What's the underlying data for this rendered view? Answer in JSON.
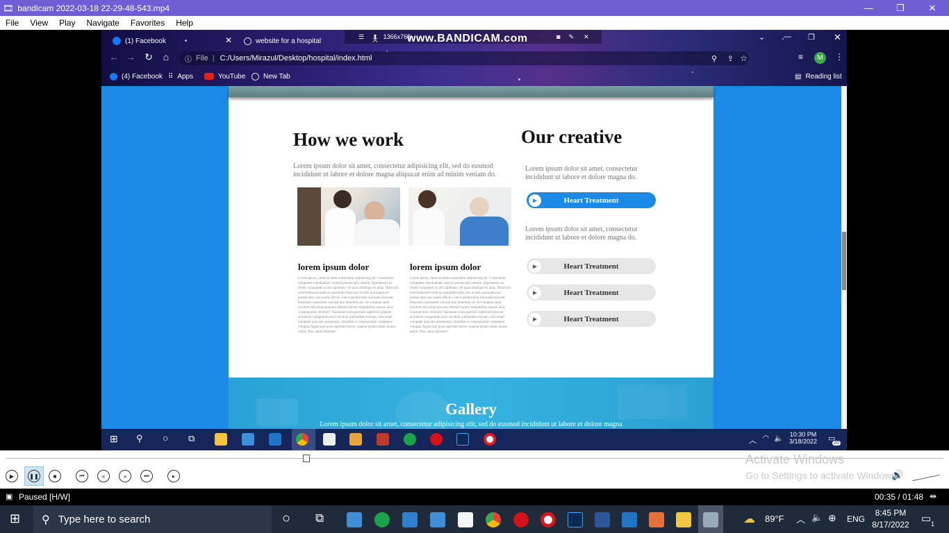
{
  "player": {
    "title": "bandicam 2022-03-18 22-29-48-543.mp4",
    "menu": [
      "File",
      "View",
      "Play",
      "Navigate",
      "Favorites",
      "Help"
    ],
    "status": "Paused [H/W]",
    "time": "00:35 / 01:48"
  },
  "overlay": {
    "resolution": "1366x768",
    "watermark": "www.BANDICAM.com"
  },
  "browser": {
    "tabs": [
      {
        "label": "(1) Facebook"
      },
      {
        "label": "website for a hospital"
      }
    ],
    "address_prefix": "File",
    "address": "C:/Users/Mirazul/Desktop/hospital/index.html",
    "bookmarks": [
      "(4) Facebook",
      "Apps",
      "YouTube",
      "New Tab"
    ],
    "reading_list": "Reading list",
    "profile_initial": "M"
  },
  "page": {
    "how_title": "How we work",
    "how_text": "Lorem ipsum dolor sit amet, consectetur adipisicing elit, sed do eusmod incididunt ut labore et dolore magna aliqua.ut enim ad minim veniam do.",
    "card1_title": "lorem ipsum dolor",
    "card2_title": "lorem ipsum dolor",
    "card_text": "Lorem ipsum, dolor sit amet consectetur adipisicing elit. Consectetur voluptates repudiandae corporis perspiciatis ratione, dignissimos ea rerum voluptatem ut ad cupiditate, vel quas similique ex alias. Distinctio exercitationem unde accusantium natus sint ut odio quisquam eos perspiciatis, non quam officiis, iure expedita totiu ruscundo nesciunt. Deserunt consectetur suscipit quo blanditiis sit, vel voluptas quod incidunt sed soluta maxime deleniti harum voluptatibus ratione alias consequuntur dolorem? Nastquam nulla aperiam asperiores placeat architecto voluptatum sunt! incidunt quibusdam corrupti, odit totam voluptate quia iste assumenda, blanditiis et consequuntur voluptates voluptas fugiat sunt porro aperiam facere, quaerat ipsam omnis dolore animi. Nos, natus dolorem!",
    "creative_title": "Our creative",
    "creative_text1": "Lorem ipsum dolor sit amet, consectetur incididunt ut labore et dolore magna do.",
    "creative_text2": "Lorem ipsum dolor sit amet, consectetur incididunt ut labore et dolore magna do.",
    "treatments": [
      "Heart Treatment",
      "Heart Treatment",
      "Heart Treatment",
      "Heart Treatment"
    ],
    "gallery_title": "Gallery",
    "gallery_text": "Lorem ipsum dolor sit amet, consectetur adipisicing elit, sed do eusmod incididunt ut labore et dolore magna"
  },
  "inner_taskbar": {
    "time": "10:30 PM",
    "date": "3/18/2022",
    "notifications": "20"
  },
  "activate": {
    "title": "Activate Windows",
    "subtitle": "Go to Settings to activate Windows."
  },
  "taskbar": {
    "search_placeholder": "Type here to search",
    "weather": "89°F",
    "lang": "ENG",
    "time": "8:45 PM",
    "date": "8/17/2022",
    "notifications": "1"
  },
  "colors": {
    "page_bg": "#1a8ae6",
    "accent": "#1a8ae6",
    "player_title": "#6f5fd6"
  }
}
